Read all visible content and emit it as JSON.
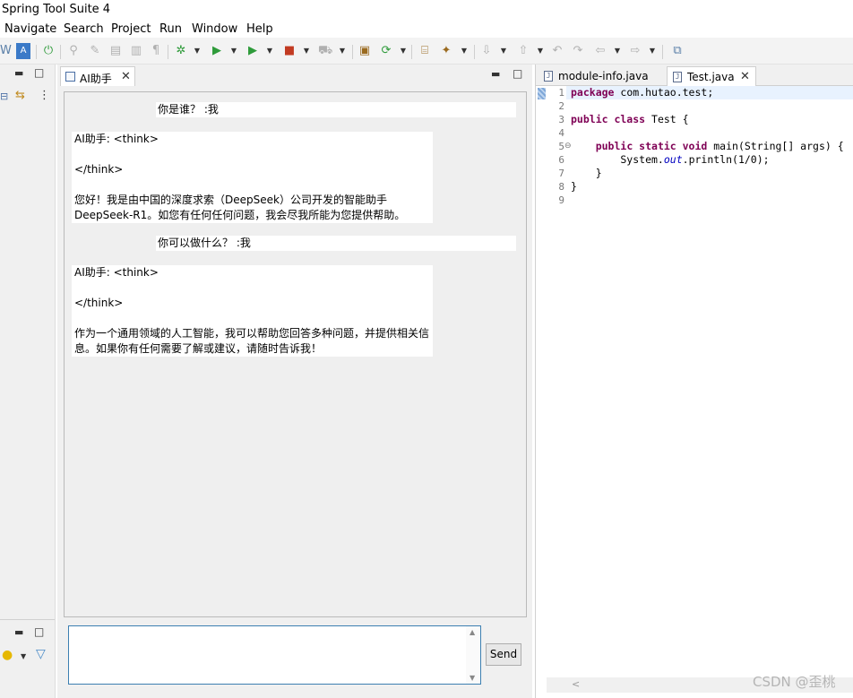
{
  "window": {
    "title": "Spring Tool Suite 4"
  },
  "menu": [
    "Navigate",
    "Search",
    "Project",
    "Run",
    "Window",
    "Help"
  ],
  "toolbar": {
    "icons": [
      "workbench-icon",
      "app-icon",
      "power-icon",
      "pin-icon",
      "edit-icon",
      "doc-icon",
      "pilcrow-icon",
      "debug-icon",
      "run-icon",
      "run-external-icon",
      "stop-icon",
      "deploy-icon",
      "package-icon",
      "refresh-icon",
      "open-type-icon",
      "search-icon",
      "next-annotation-icon",
      "prev-annotation-icon",
      "last-edit-icon",
      "back-icon",
      "forward-icon",
      "new-task-icon"
    ]
  },
  "left_view": {
    "bottom_icons": [
      "lightbulb-icon",
      "filter-icon"
    ]
  },
  "ai_view": {
    "tab_label": "AI助手",
    "close_glyph": "✕",
    "messages": [
      {
        "role": "user",
        "text": "你是谁？ :我"
      },
      {
        "role": "assistant",
        "text": "AI助手: <think>\n\n</think>\n\n您好！我是由中国的深度求索（DeepSeek）公司开发的智能助手DeepSeek-R1。如您有任何任何问题，我会尽我所能为您提供帮助。"
      },
      {
        "role": "user",
        "text": "你可以做什么？ :我"
      },
      {
        "role": "assistant",
        "text": "AI助手: <think>\n\n</think>\n\n作为一个通用领域的人工智能，我可以帮助您回答多种问题，并提供相关信息。如果你有任何需要了解或建议，请随时告诉我！"
      }
    ],
    "input": {
      "value": "",
      "placeholder": ""
    },
    "send_label": "Send"
  },
  "editor": {
    "tabs": [
      {
        "label": "module-info.java",
        "active": false
      },
      {
        "label": "Test.java",
        "active": true
      }
    ],
    "line_numbers": [
      "1",
      "2",
      "3",
      "4",
      "5",
      "6",
      "7",
      "8",
      "9"
    ],
    "code": {
      "l1_kw": "package",
      "l1_rest": " com.hutao.test;",
      "l3_kw": "public class",
      "l3_rest": " Test {",
      "l5_indent": "    ",
      "l5_kw": "public static void",
      "l5_rest": " main(String[] args) {",
      "l6_pre": "        System.",
      "l6_field": "out",
      "l6_rest": ".println(1/0);",
      "l7": "    }",
      "l8": "}"
    }
  },
  "watermark": "CSDN @歪桃",
  "colors": {
    "keyword": "#7f0055",
    "field": "#0000c0",
    "input_border": "#3c7fb1",
    "current_line": "#e8f2fe"
  }
}
